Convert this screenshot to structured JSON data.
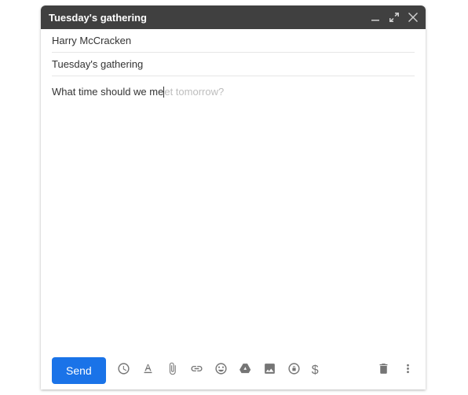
{
  "titlebar": {
    "title": "Tuesday's gathering"
  },
  "fields": {
    "to": "Harry McCracken",
    "subject": "Tuesday's gathering"
  },
  "body": {
    "typed": "What time should we me",
    "suggestion": "et tomorrow?"
  },
  "footer": {
    "send_label": "Send",
    "money_symbol": "$"
  }
}
